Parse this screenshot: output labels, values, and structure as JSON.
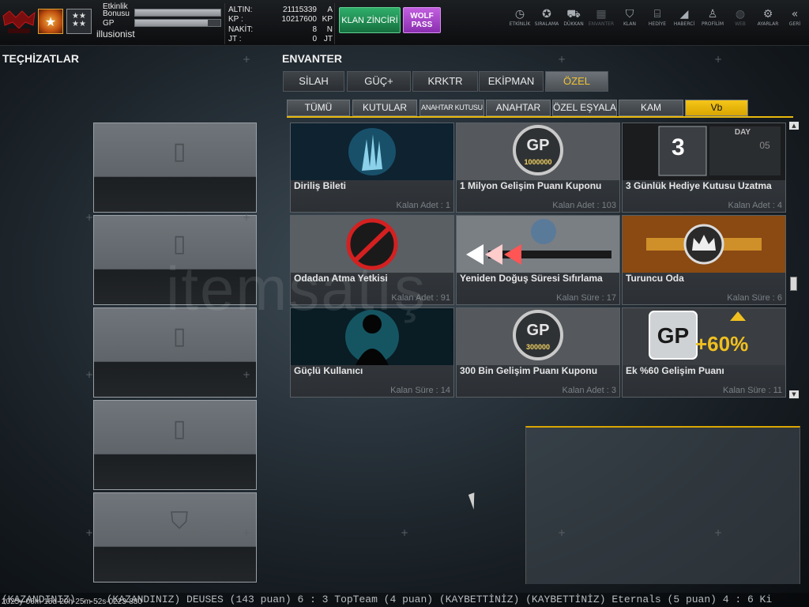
{
  "header": {
    "profile": {
      "event_bonus_label": "Etkinlik Bonusu",
      "event_bonus_progress": 1.0,
      "gp_label": "GP",
      "gp_progress": 0.85,
      "username": "illusionist"
    },
    "currency": [
      {
        "label": "ALTIN:",
        "value": "21115339",
        "unit": "A"
      },
      {
        "label": "KP :",
        "value": "10217600",
        "unit": "KP"
      },
      {
        "label": "NAKİT:",
        "value": "8",
        "unit": "N"
      },
      {
        "label": "JT :",
        "value": "0",
        "unit": "JT"
      }
    ],
    "klan_button": "KLAN ZİNCİRİ",
    "wolf_button": "WOLF PASS",
    "nav": [
      {
        "label": "ETKİNLİK",
        "icon": "stopwatch-icon",
        "glyph": "◷",
        "enabled": true
      },
      {
        "label": "SIRALAMA",
        "icon": "medal-icon",
        "glyph": "✪",
        "enabled": true
      },
      {
        "label": "DÜKKAN",
        "icon": "cart-icon",
        "glyph": "⛟",
        "enabled": true
      },
      {
        "label": "ENVANTER",
        "icon": "inventory-icon",
        "glyph": "▦",
        "enabled": false
      },
      {
        "label": "KLAN",
        "icon": "clan-shield-icon",
        "glyph": "⛉",
        "enabled": true
      },
      {
        "label": "HEDİYE",
        "icon": "gift-icon",
        "glyph": "⌸",
        "enabled": true
      },
      {
        "label": "HABERCİ",
        "icon": "megaphone-icon",
        "glyph": "◢",
        "enabled": true
      },
      {
        "label": "PROFİLİM",
        "icon": "profile-icon",
        "glyph": "♙",
        "enabled": true
      },
      {
        "label": "WEB",
        "icon": "globe-icon",
        "glyph": "◍",
        "enabled": false
      },
      {
        "label": "AYARLAR",
        "icon": "gear-icon",
        "glyph": "⚙",
        "enabled": true
      },
      {
        "label": "GERİ",
        "icon": "back-icon",
        "glyph": "«",
        "enabled": true
      }
    ]
  },
  "equipment": {
    "title": "TEÇHİZATLAR",
    "slots": [
      {
        "icon": "spray-can-icon",
        "glyph": "▯"
      },
      {
        "icon": "spray-can-icon",
        "glyph": "▯"
      },
      {
        "icon": "spray-can-icon",
        "glyph": "▯"
      },
      {
        "icon": "spray-can-icon",
        "glyph": "▯"
      },
      {
        "icon": "shield-icon",
        "glyph": "⛉"
      }
    ]
  },
  "inventory": {
    "title": "ENVANTER",
    "tabs": [
      "SİLAH",
      "GÜÇ+",
      "KRKTR",
      "EKİPMAN",
      "ÖZEL"
    ],
    "active_tab": "ÖZEL",
    "subtabs": [
      "TÜMÜ",
      "KUTULAR",
      "ANAHTAR KUTUSU",
      "ANAHTAR",
      "ÖZEL EŞYALAR",
      "KAM",
      "Vb"
    ],
    "active_subtab": "Vb",
    "items": [
      {
        "name": "Diriliş Bileti",
        "meta": "Kalan Adet : 1",
        "art": "hand-splash-icon"
      },
      {
        "name": "1 Milyon Gelişim Puanı Kuponu",
        "meta": "Kalan Adet : 103",
        "art": "gp-coin-icon",
        "art_text": "1000000"
      },
      {
        "name": "3 Günlük Hediye Kutusu Uzatma",
        "meta": "Kalan Adet : 4",
        "art": "calendar-icon",
        "art_text": "3"
      },
      {
        "name": "Odadan Atma Yetkisi",
        "meta": "Kalan Adet : 91",
        "art": "no-entry-icon"
      },
      {
        "name": "Yeniden Doğuş Süresi Sıfırlama",
        "meta": "Kalan Süre : 17",
        "art": "respawn-arrows-icon"
      },
      {
        "name": "Turuncu Oda",
        "meta": "Kalan Süre : 6",
        "art": "crown-icon"
      },
      {
        "name": "Güçlü Kullanıcı",
        "meta": "Kalan Süre : 14",
        "art": "aura-silhouette-icon"
      },
      {
        "name": "300 Bin Gelişim Puanı Kuponu",
        "meta": "Kalan Adet : 3",
        "art": "gp-coin-icon",
        "art_text": "300000"
      },
      {
        "name": "Ek %60 Gelişim Puanı",
        "meta": "Kalan Süre : 11",
        "art": "gp-boost-icon",
        "art_text": "+60%"
      }
    ]
  },
  "watermark": "itemsatış",
  "ticker": "(KAZANDINIZ) ... (KAZANDINIZ) DEUSES (143 puan) 6 : 3 TopTeam (4 puan) (KAYBETTİNİZ)     (KAYBETTİNİZ) Eternals (5 puan) 4 : 6 Ki",
  "timestamp": "2025y-06m-15d-20h-25m-52s-0223-880"
}
